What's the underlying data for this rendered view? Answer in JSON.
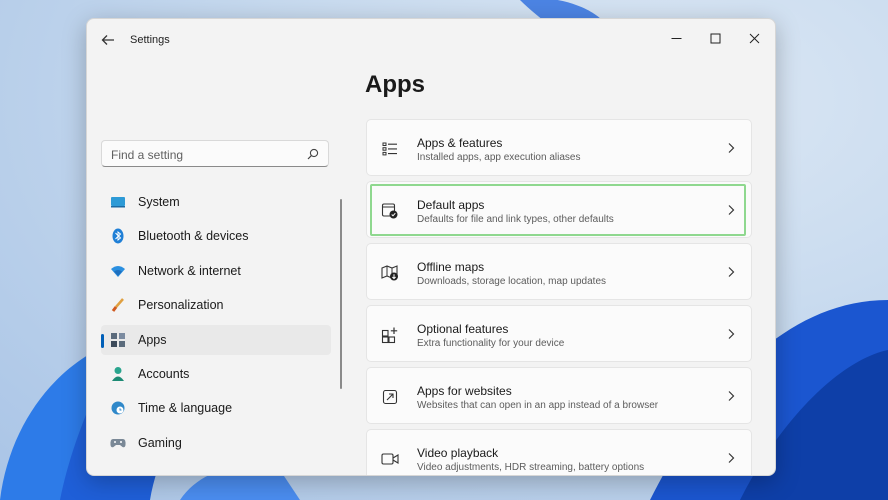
{
  "window": {
    "title": "Settings"
  },
  "search": {
    "placeholder": "Find a setting"
  },
  "nav": {
    "items": [
      {
        "label": "System"
      },
      {
        "label": "Bluetooth & devices"
      },
      {
        "label": "Network & internet"
      },
      {
        "label": "Personalization"
      },
      {
        "label": "Apps"
      },
      {
        "label": "Accounts"
      },
      {
        "label": "Time & language"
      },
      {
        "label": "Gaming"
      }
    ],
    "selected": "Apps"
  },
  "main": {
    "title": "Apps",
    "cards": [
      {
        "title": "Apps & features",
        "subtitle": "Installed apps, app execution aliases",
        "icon": "apps-features-icon"
      },
      {
        "title": "Default apps",
        "subtitle": "Defaults for file and link types, other defaults",
        "icon": "default-apps-icon",
        "highlighted": true
      },
      {
        "title": "Offline maps",
        "subtitle": "Downloads, storage location, map updates",
        "icon": "offline-maps-icon"
      },
      {
        "title": "Optional features",
        "subtitle": "Extra functionality for your device",
        "icon": "optional-features-icon"
      },
      {
        "title": "Apps for websites",
        "subtitle": "Websites that can open in an app instead of a browser",
        "icon": "apps-for-websites-icon"
      },
      {
        "title": "Video playback",
        "subtitle": "Video adjustments, HDR streaming, battery options",
        "icon": "video-playback-icon"
      }
    ]
  },
  "colors": {
    "accent": "#005fb8",
    "highlight": "#8fd88f",
    "wallpaper_bloom": "#1a5fe0"
  }
}
